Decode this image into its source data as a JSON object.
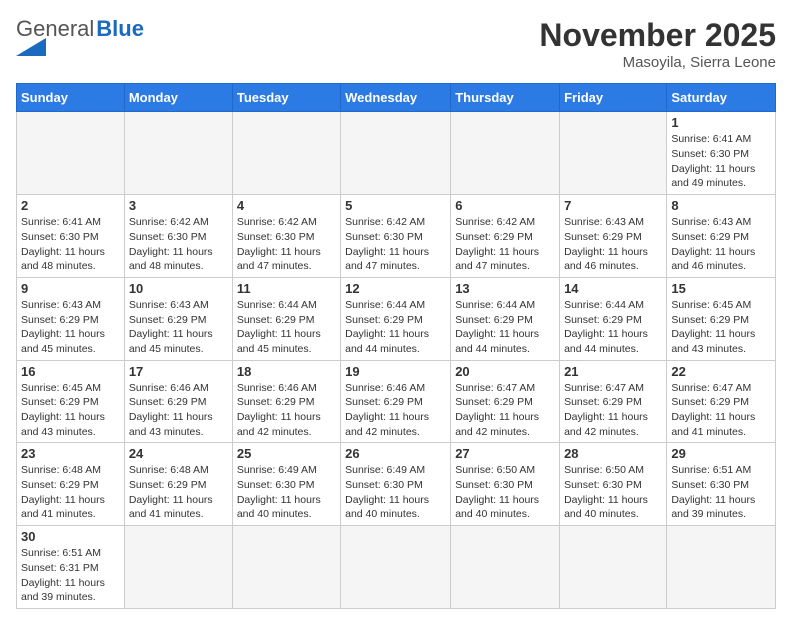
{
  "header": {
    "logo_general": "General",
    "logo_blue": "Blue",
    "month_title": "November 2025",
    "location": "Masoyila, Sierra Leone"
  },
  "days_of_week": [
    "Sunday",
    "Monday",
    "Tuesday",
    "Wednesday",
    "Thursday",
    "Friday",
    "Saturday"
  ],
  "weeks": [
    [
      {
        "day": "",
        "info": ""
      },
      {
        "day": "",
        "info": ""
      },
      {
        "day": "",
        "info": ""
      },
      {
        "day": "",
        "info": ""
      },
      {
        "day": "",
        "info": ""
      },
      {
        "day": "",
        "info": ""
      },
      {
        "day": "1",
        "info": "Sunrise: 6:41 AM\nSunset: 6:30 PM\nDaylight: 11 hours\nand 49 minutes."
      }
    ],
    [
      {
        "day": "2",
        "info": "Sunrise: 6:41 AM\nSunset: 6:30 PM\nDaylight: 11 hours\nand 48 minutes."
      },
      {
        "day": "3",
        "info": "Sunrise: 6:42 AM\nSunset: 6:30 PM\nDaylight: 11 hours\nand 48 minutes."
      },
      {
        "day": "4",
        "info": "Sunrise: 6:42 AM\nSunset: 6:30 PM\nDaylight: 11 hours\nand 47 minutes."
      },
      {
        "day": "5",
        "info": "Sunrise: 6:42 AM\nSunset: 6:30 PM\nDaylight: 11 hours\nand 47 minutes."
      },
      {
        "day": "6",
        "info": "Sunrise: 6:42 AM\nSunset: 6:29 PM\nDaylight: 11 hours\nand 47 minutes."
      },
      {
        "day": "7",
        "info": "Sunrise: 6:43 AM\nSunset: 6:29 PM\nDaylight: 11 hours\nand 46 minutes."
      },
      {
        "day": "8",
        "info": "Sunrise: 6:43 AM\nSunset: 6:29 PM\nDaylight: 11 hours\nand 46 minutes."
      }
    ],
    [
      {
        "day": "9",
        "info": "Sunrise: 6:43 AM\nSunset: 6:29 PM\nDaylight: 11 hours\nand 45 minutes."
      },
      {
        "day": "10",
        "info": "Sunrise: 6:43 AM\nSunset: 6:29 PM\nDaylight: 11 hours\nand 45 minutes."
      },
      {
        "day": "11",
        "info": "Sunrise: 6:44 AM\nSunset: 6:29 PM\nDaylight: 11 hours\nand 45 minutes."
      },
      {
        "day": "12",
        "info": "Sunrise: 6:44 AM\nSunset: 6:29 PM\nDaylight: 11 hours\nand 44 minutes."
      },
      {
        "day": "13",
        "info": "Sunrise: 6:44 AM\nSunset: 6:29 PM\nDaylight: 11 hours\nand 44 minutes."
      },
      {
        "day": "14",
        "info": "Sunrise: 6:44 AM\nSunset: 6:29 PM\nDaylight: 11 hours\nand 44 minutes."
      },
      {
        "day": "15",
        "info": "Sunrise: 6:45 AM\nSunset: 6:29 PM\nDaylight: 11 hours\nand 43 minutes."
      }
    ],
    [
      {
        "day": "16",
        "info": "Sunrise: 6:45 AM\nSunset: 6:29 PM\nDaylight: 11 hours\nand 43 minutes."
      },
      {
        "day": "17",
        "info": "Sunrise: 6:46 AM\nSunset: 6:29 PM\nDaylight: 11 hours\nand 43 minutes."
      },
      {
        "day": "18",
        "info": "Sunrise: 6:46 AM\nSunset: 6:29 PM\nDaylight: 11 hours\nand 42 minutes."
      },
      {
        "day": "19",
        "info": "Sunrise: 6:46 AM\nSunset: 6:29 PM\nDaylight: 11 hours\nand 42 minutes."
      },
      {
        "day": "20",
        "info": "Sunrise: 6:47 AM\nSunset: 6:29 PM\nDaylight: 11 hours\nand 42 minutes."
      },
      {
        "day": "21",
        "info": "Sunrise: 6:47 AM\nSunset: 6:29 PM\nDaylight: 11 hours\nand 42 minutes."
      },
      {
        "day": "22",
        "info": "Sunrise: 6:47 AM\nSunset: 6:29 PM\nDaylight: 11 hours\nand 41 minutes."
      }
    ],
    [
      {
        "day": "23",
        "info": "Sunrise: 6:48 AM\nSunset: 6:29 PM\nDaylight: 11 hours\nand 41 minutes."
      },
      {
        "day": "24",
        "info": "Sunrise: 6:48 AM\nSunset: 6:29 PM\nDaylight: 11 hours\nand 41 minutes."
      },
      {
        "day": "25",
        "info": "Sunrise: 6:49 AM\nSunset: 6:30 PM\nDaylight: 11 hours\nand 40 minutes."
      },
      {
        "day": "26",
        "info": "Sunrise: 6:49 AM\nSunset: 6:30 PM\nDaylight: 11 hours\nand 40 minutes."
      },
      {
        "day": "27",
        "info": "Sunrise: 6:50 AM\nSunset: 6:30 PM\nDaylight: 11 hours\nand 40 minutes."
      },
      {
        "day": "28",
        "info": "Sunrise: 6:50 AM\nSunset: 6:30 PM\nDaylight: 11 hours\nand 40 minutes."
      },
      {
        "day": "29",
        "info": "Sunrise: 6:51 AM\nSunset: 6:30 PM\nDaylight: 11 hours\nand 39 minutes."
      }
    ],
    [
      {
        "day": "30",
        "info": "Sunrise: 6:51 AM\nSunset: 6:31 PM\nDaylight: 11 hours\nand 39 minutes."
      },
      {
        "day": "",
        "info": ""
      },
      {
        "day": "",
        "info": ""
      },
      {
        "day": "",
        "info": ""
      },
      {
        "day": "",
        "info": ""
      },
      {
        "day": "",
        "info": ""
      },
      {
        "day": "",
        "info": ""
      }
    ]
  ]
}
